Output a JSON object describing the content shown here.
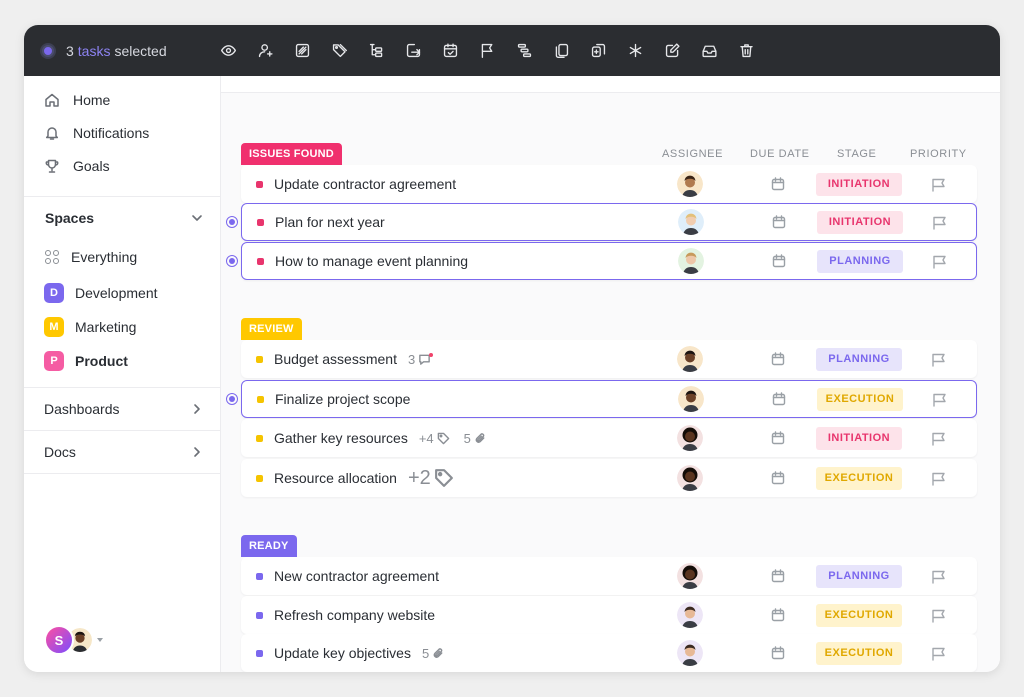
{
  "toolbar": {
    "count": "3",
    "tasks_word": "tasks",
    "selected_word": "selected",
    "icons": [
      "eye-icon",
      "add-assignee-icon",
      "status-icon",
      "tag-icon",
      "subtask-icon",
      "move-icon",
      "calendar-check-icon",
      "flag-icon",
      "list-icon",
      "copy-icon",
      "duplicate-icon",
      "asterisk-icon",
      "edit-icon",
      "inbox-icon",
      "trash-icon"
    ]
  },
  "sidebar": {
    "nav": [
      {
        "label": "Home",
        "icon": "home-icon"
      },
      {
        "label": "Notifications",
        "icon": "bell-icon"
      },
      {
        "label": "Goals",
        "icon": "trophy-icon"
      }
    ],
    "spaces_label": "Spaces",
    "everything_label": "Everything",
    "spaces": [
      {
        "letter": "D",
        "label": "Development",
        "color": "#7b68ee"
      },
      {
        "letter": "M",
        "label": "Marketing",
        "color": "#ffc800"
      },
      {
        "letter": "P",
        "label": "Product",
        "color": "#f55ca3"
      }
    ],
    "dashboards_label": "Dashboards",
    "docs_label": "Docs",
    "user_initial": "S"
  },
  "columns": {
    "assignee": "ASSIGNEE",
    "due_date": "DUE DATE",
    "stage": "STAGE",
    "priority": "PRIORITY"
  },
  "groups": [
    {
      "label": "ISSUES FOUND",
      "bg": "#f0306e",
      "fg": "#ffffff",
      "square": "#e8356d",
      "tasks": [
        {
          "name": "Update contractor agreement",
          "selected": false,
          "stage": "INITIATION",
          "avatar": "a"
        },
        {
          "name": "Plan for next year",
          "selected": true,
          "stage": "INITIATION",
          "avatar": "b"
        },
        {
          "name": "How to manage event planning",
          "selected": true,
          "stage": "PLANNING",
          "avatar": "c"
        }
      ]
    },
    {
      "label": "REVIEW",
      "bg": "#ffc800",
      "fg": "#ffffff",
      "square": "#f5c400",
      "tasks": [
        {
          "name": "Budget assessment",
          "selected": false,
          "stage": "PLANNING",
          "avatar": "d",
          "meta": {
            "comments": "3"
          }
        },
        {
          "name": "Finalize project scope",
          "selected": true,
          "stage": "EXECUTION",
          "avatar": "d"
        },
        {
          "name": "Gather key resources",
          "selected": false,
          "stage": "INITIATION",
          "avatar": "e",
          "meta": {
            "tags": "+4",
            "attachments": "5"
          }
        },
        {
          "name": "Resource allocation",
          "selected": false,
          "stage": "EXECUTION",
          "avatar": "e",
          "meta": {
            "big_tags": "+2"
          }
        }
      ]
    },
    {
      "label": "READY",
      "bg": "#7b68ee",
      "fg": "#ffffff",
      "square": "#7b68ee",
      "tasks": [
        {
          "name": "New contractor agreement",
          "selected": false,
          "stage": "PLANNING",
          "avatar": "e"
        },
        {
          "name": "Refresh company website",
          "selected": false,
          "stage": "EXECUTION",
          "avatar": "f"
        },
        {
          "name": "Update key objectives",
          "selected": false,
          "stage": "EXECUTION",
          "avatar": "f",
          "meta": {
            "attachments": "5"
          }
        }
      ]
    }
  ],
  "stage_colors": {
    "INITIATION": {
      "bg": "#fde3ea",
      "fg": "#e8356d"
    },
    "PLANNING": {
      "bg": "#e7e4fb",
      "fg": "#7b68ee"
    },
    "EXECUTION": {
      "bg": "#fff3cc",
      "fg": "#e0a800"
    }
  }
}
